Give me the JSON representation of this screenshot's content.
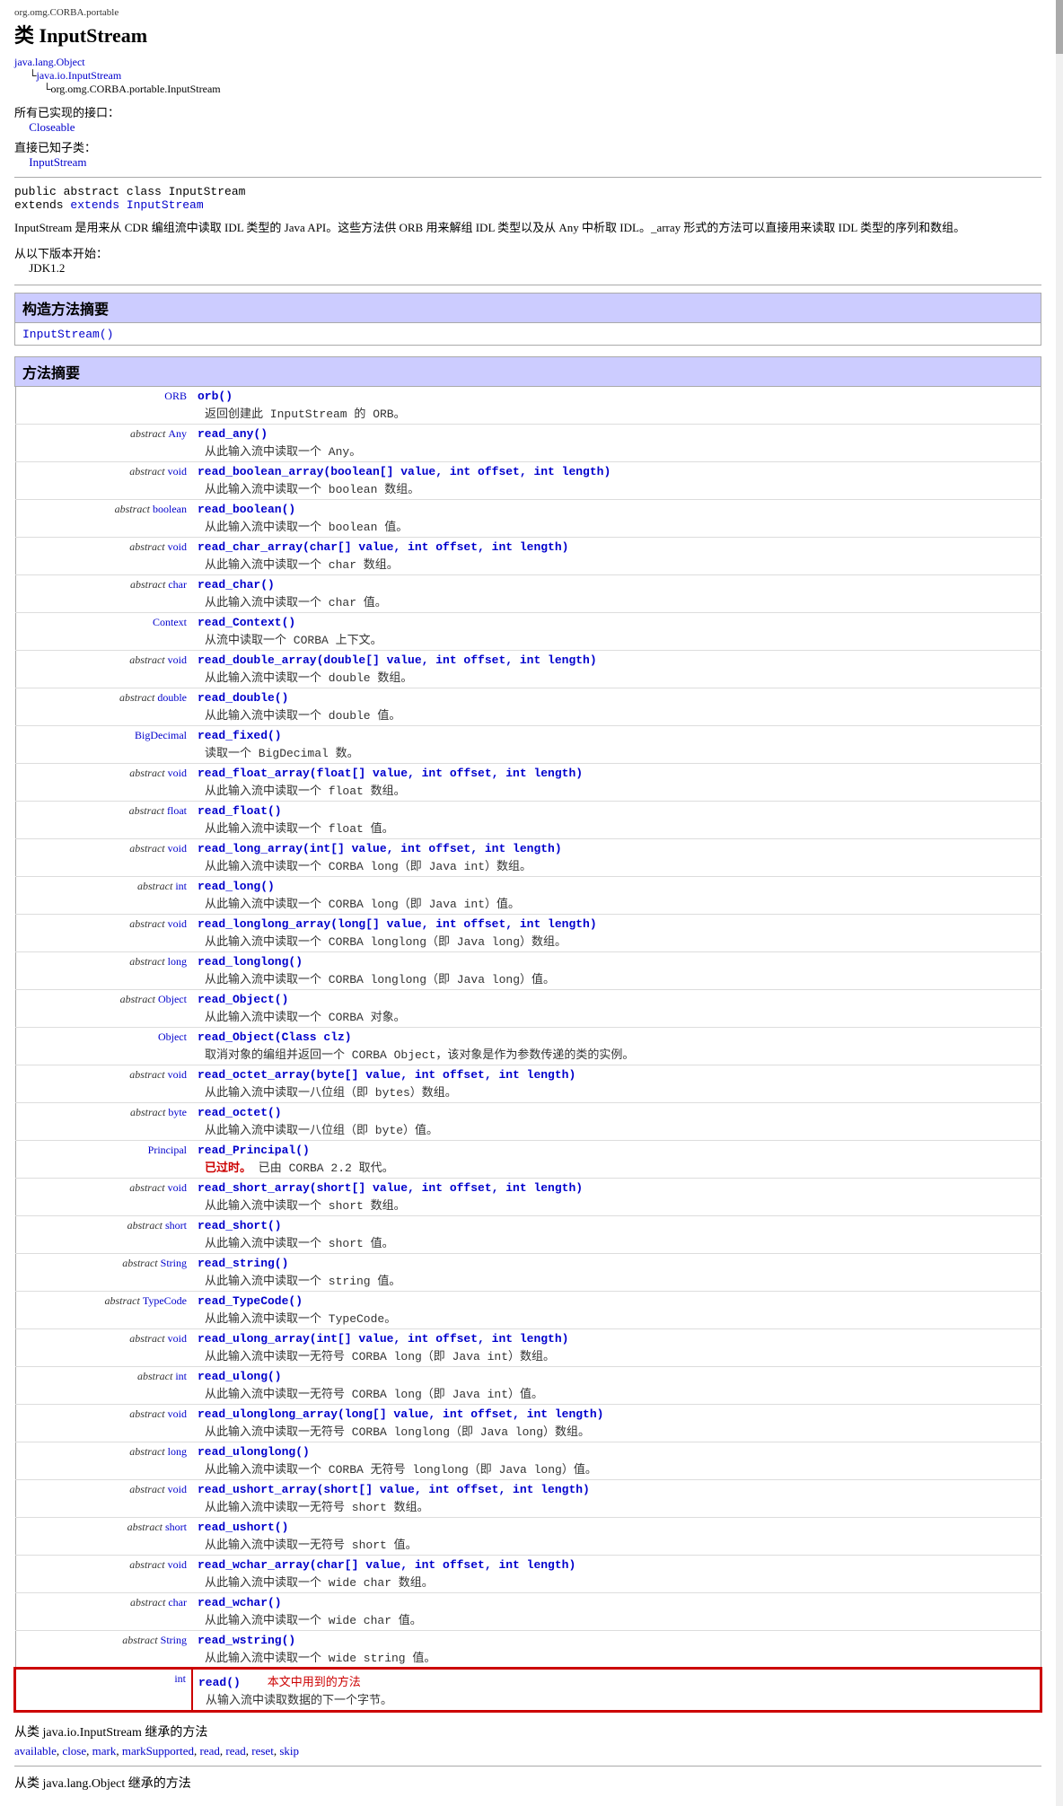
{
  "package": {
    "name": "org.omg.CORBA.portable",
    "class_type": "类",
    "class_name": "InputStream"
  },
  "hierarchy": {
    "root": "java.lang.Object",
    "level1": "java.io.InputStream",
    "level2": "org.omg.CORBA.portable.InputStream"
  },
  "interfaces_label": "所有已实现的接口：",
  "interface": "Closeable",
  "subclasses_label": "直接已知子类：",
  "subclass": "InputStream",
  "class_signature_line1": "public abstract class InputStream",
  "class_signature_line2": "extends InputStream",
  "class_description": "InputStream 是用来从 CDR 编组流中读取 IDL 类型的 Java API。这些方法供 ORB 用来解组 IDL 类型以及从 Any 中析取 IDL。_array 形式的方法可以直接用来读取 IDL 类型的序列和数组。",
  "since_label": "从以下版本开始：",
  "since_version": "JDK1.2",
  "constructor_summary": {
    "header": "构造方法摘要",
    "entry": "InputStream()"
  },
  "method_summary": {
    "header": "方法摘要",
    "methods": [
      {
        "return_type": "ORB",
        "return_link": "ORB",
        "method": "orb()",
        "description": "返回创建此 InputStream 的 ORB。",
        "keyword": "orb"
      },
      {
        "return_type": "abstract Any",
        "return_link": "",
        "method": "read_any()",
        "description": "从此输入流中读取一个 Any。",
        "keyword": "abstract Any"
      },
      {
        "return_type": "abstract void",
        "return_link": "",
        "method": "read_boolean_array(boolean[] value, int offset, int length)",
        "description": "从此输入流中读取一个 boolean 数组。",
        "keyword": "abstract void"
      },
      {
        "return_type": "abstract boolean",
        "return_link": "",
        "method": "read_boolean()",
        "description": "从此输入流中读取一个 boolean 值。",
        "keyword": "abstract boolean"
      },
      {
        "return_type": "abstract void",
        "return_link": "",
        "method": "read_char_array(char[] value, int offset, int length)",
        "description": "从此输入流中读取一个 char 数组。",
        "keyword": "abstract void"
      },
      {
        "return_type": "abstract char",
        "return_link": "",
        "method": "read_char()",
        "description": "从此输入流中读取一个 char 值。",
        "keyword": "abstract char"
      },
      {
        "return_type": "Context",
        "return_link": "Context",
        "method": "read_Context()",
        "description": "从流中读取一个 CORBA 上下文。",
        "keyword": "Context"
      },
      {
        "return_type": "abstract void",
        "return_link": "",
        "method": "read_double_array(double[] value, int offset, int length)",
        "description": "从此输入流中读取一个 double 数组。",
        "keyword": "abstract void"
      },
      {
        "return_type": "abstract double",
        "return_link": "",
        "method": "read_double()",
        "description": "从此输入流中读取一个 double 值。",
        "keyword": "abstract double"
      },
      {
        "return_type": "BigDecimal",
        "return_link": "BigDecimal",
        "method": "read_fixed()",
        "description": "读取一个 BigDecimal 数。",
        "keyword": "BigDecimal"
      },
      {
        "return_type": "abstract void",
        "return_link": "",
        "method": "read_float_array(float[] value, int offset, int length)",
        "description": "从此输入流中读取一个 float 数组。",
        "keyword": "abstract void"
      },
      {
        "return_type": "abstract float",
        "return_link": "",
        "method": "read_float()",
        "description": "从此输入流中读取一个 float 值。",
        "keyword": "abstract float"
      },
      {
        "return_type": "abstract void",
        "return_link": "",
        "method": "read_long_array(int[] value, int offset, int length)",
        "description": "从此输入流中读取一个 CORBA long（即 Java int）数组。",
        "keyword": "abstract void"
      },
      {
        "return_type": "abstract int",
        "return_link": "",
        "method": "read_long()",
        "description": "从此输入流中读取一个 CORBA long（即 Java int）值。",
        "keyword": "abstract int"
      },
      {
        "return_type": "abstract void",
        "return_link": "",
        "method": "read_longlong_array(long[] value, int offset, int length)",
        "description": "从此输入流中读取一个 CORBA longlong（即 Java long）数组。",
        "keyword": "abstract void"
      },
      {
        "return_type": "abstract long",
        "return_link": "",
        "method": "read_longlong()",
        "description": "从此输入流中读取一个 CORBA longlong（即 Java long）值。",
        "keyword": "abstract long"
      },
      {
        "return_type": "abstract Object",
        "return_link": "",
        "method": "read_Object()",
        "description": "从此输入流中读取一个 CORBA 对象。",
        "keyword": "abstract Object"
      },
      {
        "return_type": "Object",
        "return_link": "Object",
        "method": "read_Object(Class clz)",
        "description": "取消对象的编组并返回一个 CORBA Object，该对象是作为参数传递的类的实例。",
        "keyword": "Object"
      },
      {
        "return_type": "abstract void",
        "return_link": "",
        "method": "read_octet_array(byte[] value, int offset, int length)",
        "description": "从此输入流中读取一八位组（即 bytes）数组。",
        "keyword": "abstract void"
      },
      {
        "return_type": "abstract byte",
        "return_link": "",
        "method": "read_octet()",
        "description": "从此输入流中读取一八位组（即 byte）值。",
        "keyword": "abstract byte"
      },
      {
        "return_type": "Principal",
        "return_link": "Principal",
        "method": "read_Principal()",
        "description": "已过时。  已由 CORBA 2.2 取代。",
        "keyword": "Principal",
        "deprecated": true
      },
      {
        "return_type": "abstract void",
        "return_link": "",
        "method": "read_short_array(short[] value, int offset, int length)",
        "description": "从此输入流中读取一个 short 数组。",
        "keyword": "abstract void"
      },
      {
        "return_type": "abstract short",
        "return_link": "",
        "method": "read_short()",
        "description": "从此输入流中读取一个 short 值。",
        "keyword": "abstract short"
      },
      {
        "return_type": "abstract String",
        "return_link": "",
        "method": "read_string()",
        "description": "从此输入流中读取一个 string 值。",
        "keyword": "abstract String"
      },
      {
        "return_type": "abstract TypeCode",
        "return_link": "",
        "method": "read_TypeCode()",
        "description": "从此输入流中读取一个 TypeCode。",
        "keyword": "abstract TypeCode"
      },
      {
        "return_type": "abstract void",
        "return_link": "",
        "method": "read_ulong_array(int[] value, int offset, int length)",
        "description": "从此输入流中读取一无符号 CORBA long（即 Java int）数组。",
        "keyword": "abstract void"
      },
      {
        "return_type": "abstract int",
        "return_link": "",
        "method": "read_ulong()",
        "description": "从此输入流中读取一无符号 CORBA long（即 Java int）值。",
        "keyword": "abstract int"
      },
      {
        "return_type": "abstract void",
        "return_link": "",
        "method": "read_ulonglong_array(long[] value, int offset, int length)",
        "description": "从此输入流中读取一无符号 CORBA longlong（即 Java long）数组。",
        "keyword": "abstract void"
      },
      {
        "return_type": "abstract long",
        "return_link": "",
        "method": "read_ulonglong()",
        "description": "从此输入流中读取一个 CORBA 无符号 longlong（即 Java long）值。",
        "keyword": "abstract long"
      },
      {
        "return_type": "abstract void",
        "return_link": "",
        "method": "read_ushort_array(short[] value, int offset, int length)",
        "description": "从此输入流中读取一无符号 short 数组。",
        "keyword": "abstract void"
      },
      {
        "return_type": "abstract short",
        "return_link": "",
        "method": "read_ushort()",
        "description": "从此输入流中读取一无符号 short 值。",
        "keyword": "abstract short"
      },
      {
        "return_type": "abstract void",
        "return_link": "",
        "method": "read_wchar_array(char[] value, int offset, int length)",
        "description": "从此输入流中读取一个 wide char 数组。",
        "keyword": "abstract void"
      },
      {
        "return_type": "abstract char",
        "return_link": "",
        "method": "read_wchar()",
        "description": "从此输入流中读取一个 wide char 值。",
        "keyword": "abstract char"
      },
      {
        "return_type": "abstract String",
        "return_link": "",
        "method": "read_wstring()",
        "description": "从此输入流中读取一个 wide string 值。",
        "keyword": "abstract String"
      },
      {
        "return_type": "int",
        "return_link": "",
        "method": "read()",
        "description": "从输入流中读取数据的下一个字节。",
        "keyword": "int",
        "highlight": true
      }
    ]
  },
  "inherited_from_inputstream": {
    "label": "从类 java.io.InputStream 继承的方法",
    "methods": "available, close, mark, markSupported, read, read, reset, skip"
  },
  "inherited_from_object": {
    "label": "从类 java.lang.Object 继承的方法"
  },
  "current_method_label": "本文中用到的方法"
}
